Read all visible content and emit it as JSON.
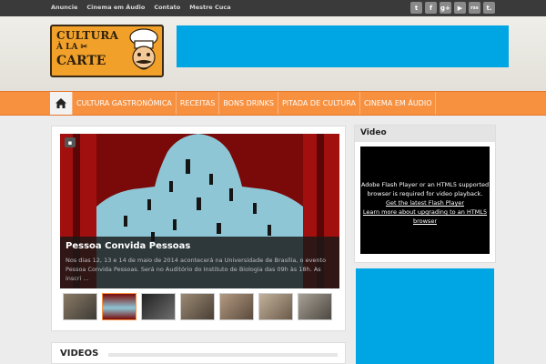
{
  "topnav": [
    "Anuncie",
    "Cinema em Áudio",
    "Contato",
    "Mestre Cuca"
  ],
  "social": [
    "twitter-icon",
    "facebook-icon",
    "google-plus-icon",
    "youtube-icon",
    "rss-icon",
    "tumblr-icon"
  ],
  "social_glyphs": [
    "t",
    "f",
    "g+",
    "▶",
    "rss",
    "t."
  ],
  "logo": {
    "line1": "CULTURA",
    "line2": "À LA ✂",
    "line3": "CARTE"
  },
  "nav": [
    "CULTURA GASTRONÔMICA",
    "RECEITAS",
    "BONS DRINKS",
    "PITADA DE CULTURA",
    "CINEMA EM ÁUDIO"
  ],
  "slider": {
    "title": "Pessoa Convida Pessoas",
    "excerpt": "Nos dias 12, 13 e 14 de maio de 2014 acontecerá na Universidade de Brasília, o evento Pessoa Convida Pessoas. Será no Auditório do Instituto de Biologia das 09h às 18h. As inscri ..."
  },
  "videos_heading": "VIDEOS",
  "video_widget": {
    "title": "Video",
    "line1": "Adobe Flash Player or an HTML5 supported browser is required for video playback.",
    "link1": "Get the latest Flash Player",
    "link2": "Learn more about upgrading to an HTML5 browser"
  },
  "colors": {
    "accent": "#f79140",
    "ad": "#00a5e3",
    "topbar": "#3a3a3a"
  }
}
